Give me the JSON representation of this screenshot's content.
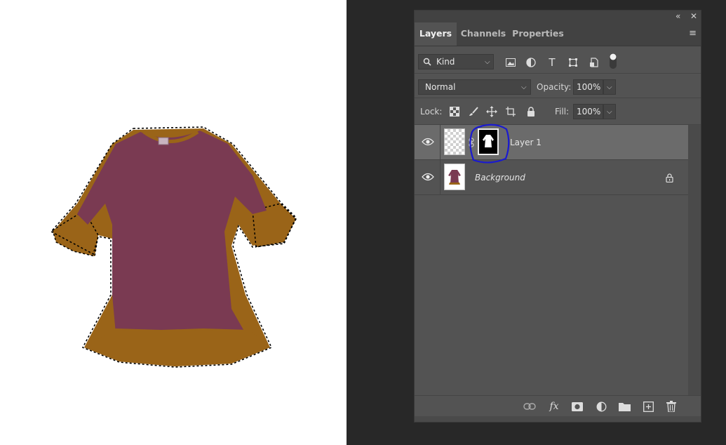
{
  "panel": {
    "collapse_glyph": "«",
    "close_glyph": "✕",
    "tabs": [
      {
        "label": "Layers",
        "active": true
      },
      {
        "label": "Channels",
        "active": false
      },
      {
        "label": "Properties",
        "active": false
      }
    ],
    "menu_glyph": "≡",
    "filter": {
      "kind_label": "Kind",
      "icons": [
        "pixel-filter-icon",
        "adjustment-filter-icon",
        "type-filter-icon",
        "shape-filter-icon",
        "smart-object-filter-icon",
        "filter-toggle-icon"
      ]
    },
    "blend": {
      "mode": "Normal",
      "opacity_label": "Opacity:",
      "opacity_value": "100%"
    },
    "lock": {
      "label": "Lock:",
      "icons": [
        "lock-transparent-pixels-icon",
        "lock-image-pixels-icon",
        "lock-position-icon",
        "lock-artboard-icon",
        "lock-all-icon"
      ],
      "fill_label": "Fill:",
      "fill_value": "100%"
    },
    "layers": [
      {
        "name": "Layer 1",
        "selected": true,
        "has_mask": true,
        "visible": true
      },
      {
        "name": "Background",
        "selected": false,
        "locked": true,
        "visible": true
      }
    ],
    "bottom_icons": [
      "link-layers-icon",
      "fx-icon",
      "add-mask-icon",
      "adjustment-layer-icon",
      "new-group-icon",
      "new-layer-icon",
      "delete-layer-icon"
    ],
    "fx_label": "fx"
  },
  "colors": {
    "panel_bg": "#535353",
    "selected_row": "#6b6b6b",
    "annotation": "#1a1ad0",
    "dress_body": "#7a3a52",
    "dress_trim": "#9a6418"
  }
}
